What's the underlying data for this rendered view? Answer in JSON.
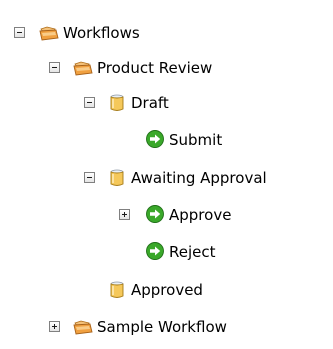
{
  "tree": {
    "root": {
      "label": "Workflows",
      "state": "expanded",
      "icon": "workflow-folder-icon"
    },
    "product_review": {
      "label": "Product Review",
      "state": "expanded",
      "icon": "workflow-folder-icon"
    },
    "draft": {
      "label": "Draft",
      "state": "expanded",
      "icon": "state-jar-icon"
    },
    "submit": {
      "label": "Submit",
      "icon": "transition-arrow-icon"
    },
    "awaiting_approval": {
      "label": "Awaiting Approval",
      "state": "expanded",
      "icon": "state-jar-icon"
    },
    "approve": {
      "label": "Approve",
      "state": "collapsed",
      "icon": "transition-arrow-icon"
    },
    "reject": {
      "label": "Reject",
      "icon": "transition-arrow-icon"
    },
    "approved": {
      "label": "Approved",
      "icon": "state-jar-icon"
    },
    "sample_workflow": {
      "label": "Sample Workflow",
      "state": "collapsed",
      "icon": "workflow-folder-icon"
    }
  },
  "colors": {
    "toggle_border": "#808080",
    "folder_orange": "#f0a040",
    "jar_yellow": "#f5c85a",
    "arrow_green": "#3aa82a"
  }
}
